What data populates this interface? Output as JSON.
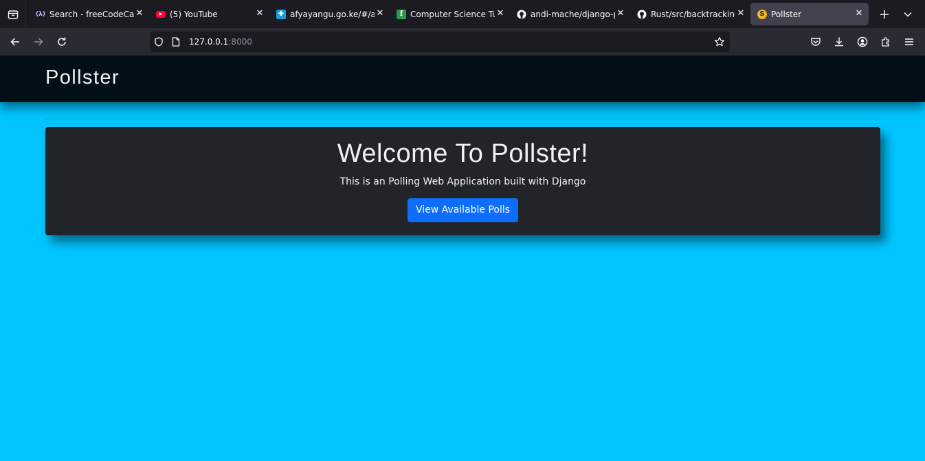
{
  "browser": {
    "tabs": [
      {
        "title": "Search - freeCodeCamp",
        "icon": "freecodecamp-favicon"
      },
      {
        "title": "(5) YouTube",
        "icon": "youtube-favicon"
      },
      {
        "title": "afyayangu.go.ke/#/acc",
        "icon": "afyayangu-favicon"
      },
      {
        "title": "Computer Science Tuto",
        "icon": "csfavicon"
      },
      {
        "title": "andi-mache/django-po",
        "icon": "github-favicon"
      },
      {
        "title": "Rust/src/backtracking/",
        "icon": "github-favicon"
      },
      {
        "title": "Pollster",
        "icon": "pollster-favicon",
        "active": true
      }
    ],
    "url_host": "127.0.0.1",
    "url_port": ":8000"
  },
  "page": {
    "brand": "Pollster",
    "heading": "Welcome To Pollster!",
    "lead": "This is an Polling Web Application built with Django",
    "button_label": "View Available Polls"
  },
  "colors": {
    "page_background": "#00c4ff",
    "header_background": "#020f17",
    "card_background": "#212529",
    "button_primary": "#0d6efd"
  }
}
